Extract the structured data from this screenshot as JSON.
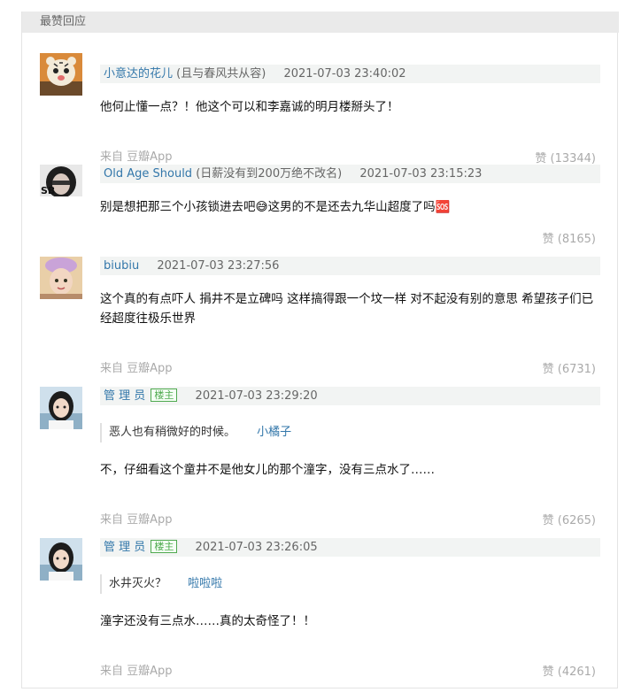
{
  "header": {
    "title": "最赞回应"
  },
  "comments": [
    {
      "name": "小意达的花儿",
      "signature": "(且与春风共从容)",
      "time": "2021-07-03 23:40:02",
      "text": "他何止懂一点？！他这个可以和李嘉诚的明月楼掰头了！",
      "source": "来自 豆瓣App",
      "likes": "赞 (13344)"
    },
    {
      "name": "Old Age Should",
      "signature": "(日薪没有到200万绝不改名)",
      "time": "2021-07-03 23:15:23",
      "avatar_text": "SB",
      "text": "别是想把那三个小孩锁进去吧😅这男的不是还去九华山超度了吗🆘",
      "likes": "赞 (8165)"
    },
    {
      "name": "biubiu",
      "time": "2021-07-03 23:27:56",
      "text": "这个真的有点吓人 捐井不是立碑吗 这样搞得跟一个坟一样 对不起没有别的意思 希望孩子们已经超度往极乐世界",
      "source": "来自 豆瓣App",
      "likes": "赞 (6731)"
    },
    {
      "name": "管 理 员",
      "tag": "楼主",
      "time": "2021-07-03 23:29:20",
      "quote_text": "恶人也有稍微好的时候。",
      "quote_name": "小橘子",
      "text": "不，仔细看这个童井不是他女儿的那个潼字，没有三点水了……",
      "source": "来自 豆瓣App",
      "likes": "赞 (6265)"
    },
    {
      "name": "管 理 员",
      "tag": "楼主",
      "time": "2021-07-03 23:26:05",
      "quote_text": "水井灭火？",
      "quote_name": "啦啦啦",
      "text": "潼字还没有三点水……真的太奇怪了！！",
      "source": "来自 豆瓣App",
      "likes": "赞 (4261)"
    }
  ]
}
